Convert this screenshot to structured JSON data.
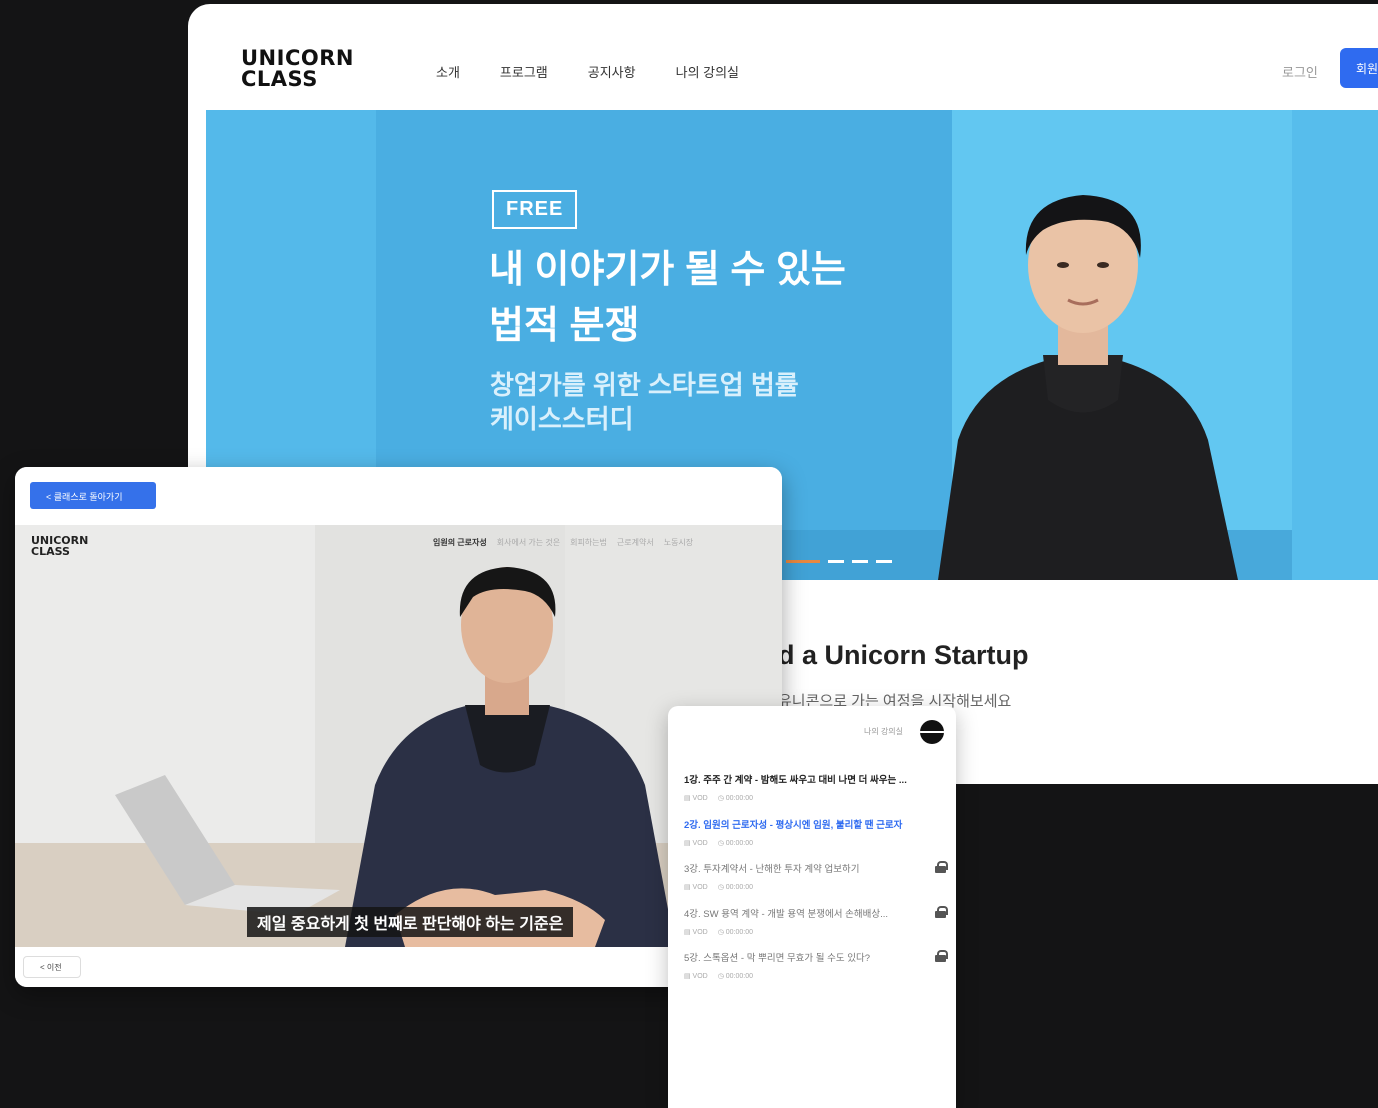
{
  "site": {
    "logo_line1": "UNICORN",
    "logo_line2": "CLASS",
    "menu": [
      "소개",
      "프로그램",
      "공지사항",
      "나의 강의실"
    ],
    "login": "로그인",
    "signup": "회원가입",
    "hero": {
      "badge": "FREE",
      "title_line1": "내 이야기가 될 수 있는",
      "title_line2": "법적 분쟁",
      "sub_line1": "창업가를 위한 스타트업 법률",
      "sub_line2": "케이스스터디",
      "slide_count": 4,
      "active_slide": 1
    },
    "slogan": "d a Unicorn Startup",
    "slogan_sub": "유니콘으로 가는 여정을 시작해보세요"
  },
  "player": {
    "back_button": "< 클래스로 돌아가기",
    "logo_line1": "UNICORN",
    "logo_line2": "CLASS",
    "chapters": [
      "임원의 근로자성",
      "회사에서 가는 것은",
      "회피하는법",
      "근로계약서",
      "노동시장"
    ],
    "active_chapter": 0,
    "subtitle": "제일 중요하게 첫 번째로 판단해야 하는 기준은",
    "prev_button": "< 이전"
  },
  "lessons": {
    "header": "나의 강의실",
    "items": [
      {
        "title": "1강. 주주 간 계약 - 밤해도 싸우고 대비 나면 더 싸우는 ...",
        "type": "VOD",
        "duration": "00:00:00",
        "state": "normal"
      },
      {
        "title": "2강. 임원의 근로자성 - 평상시엔 임원, 불리할 땐 근로자",
        "type": "VOD",
        "duration": "00:00:00",
        "state": "active"
      },
      {
        "title": "3강. 투자계약서 - 난해한 투자 계약 업보하기",
        "type": "VOD",
        "duration": "00:00:00",
        "state": "locked"
      },
      {
        "title": "4강. SW 용역 계약 - 개발 용역 분쟁에서 손해배상...",
        "type": "VOD",
        "duration": "00:00:00",
        "state": "locked"
      },
      {
        "title": "5강. 스톡옵션 - 막 뿌리면 무효가 될 수도 있다?",
        "type": "VOD",
        "duration": "00:00:00",
        "state": "locked"
      }
    ]
  },
  "colors": {
    "background": "#141415",
    "hero_blue": "#4db3e6",
    "accent_blue": "#2f6bf0",
    "active_dot": "#e88840"
  }
}
